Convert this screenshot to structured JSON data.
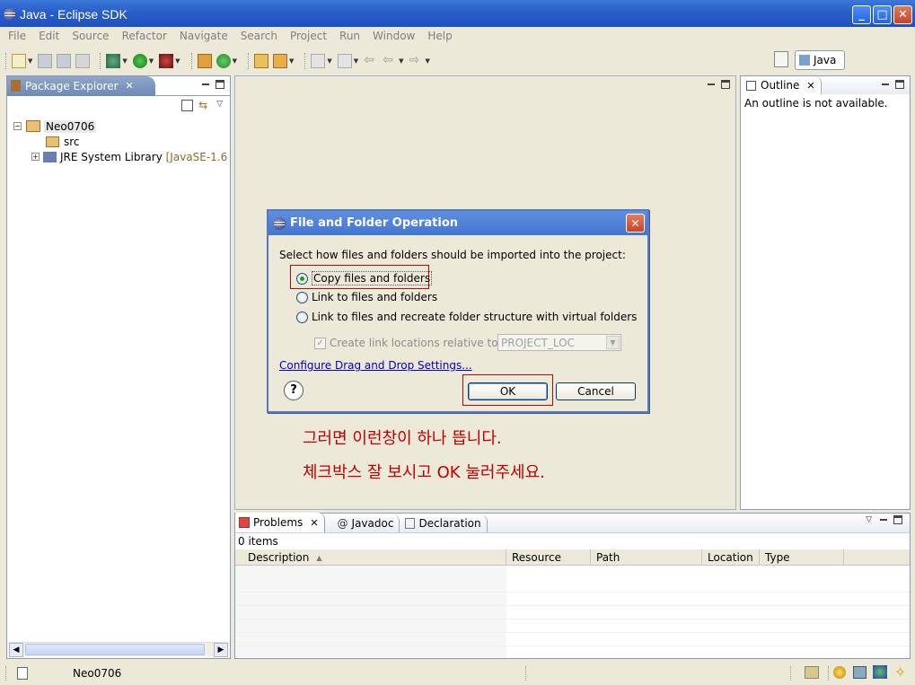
{
  "window": {
    "title": "Java - Eclipse SDK",
    "min_label": "_",
    "max_label": "□",
    "close_label": "✕"
  },
  "menu": [
    "File",
    "Edit",
    "Source",
    "Refactor",
    "Navigate",
    "Search",
    "Project",
    "Run",
    "Window",
    "Help"
  ],
  "perspective": {
    "label": "Java"
  },
  "package_explorer": {
    "tab_label": "Package Explorer",
    "project": "Neo0706",
    "src": "src",
    "jre": "JRE System Library",
    "jre_suffix": "[JavaSE-1.6"
  },
  "outline": {
    "tab_label": "Outline",
    "message": "An outline is not available."
  },
  "dialog": {
    "title": "File and Folder Operation",
    "prompt": "Select how files and folders should be imported into the project:",
    "option_copy": "Copy files and folders",
    "option_link": "Link to files and folders",
    "option_link_virtual": "Link to files and recreate folder structure with virtual folders",
    "checkbox_label": "Create link locations relative to:",
    "select_value": "PROJECT_LOC",
    "link": "Configure Drag and Drop Settings...",
    "ok": "OK",
    "cancel": "Cancel",
    "help": "?"
  },
  "annotations": {
    "line1": "그러면 이런창이 하나 뜹니다.",
    "line2": "체크박스 잘 보시고 OK 눌러주세요."
  },
  "bottom": {
    "tabs": [
      "Problems",
      "Javadoc",
      "Declaration"
    ],
    "count": "0 items",
    "columns": [
      "Description",
      "Resource",
      "Path",
      "Location",
      "Type"
    ]
  },
  "status": {
    "text": "Neo0706"
  },
  "colors": {
    "titlebar": "#2a5fc9",
    "annotation": "#c00000",
    "highlight_box": "#d00000"
  }
}
